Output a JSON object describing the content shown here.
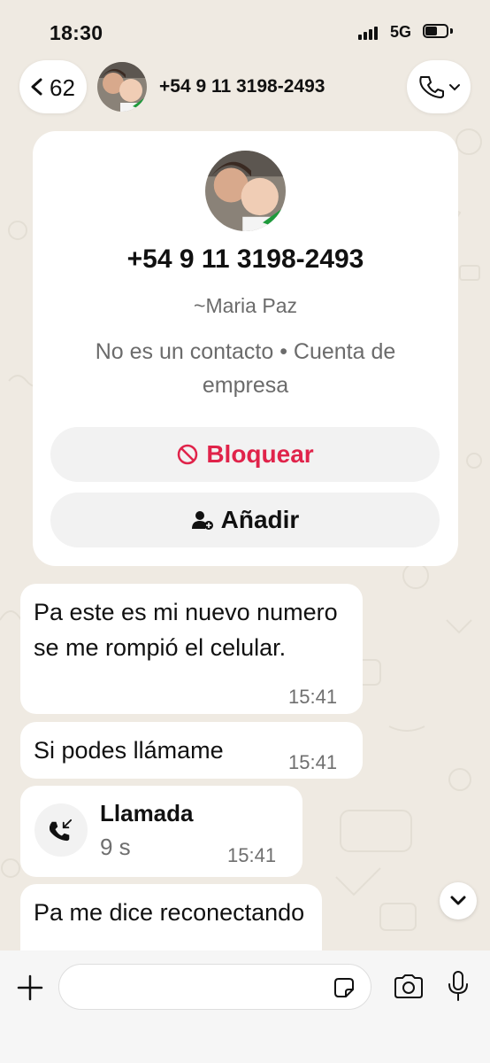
{
  "status_bar": {
    "time": "18:30",
    "network": "5G"
  },
  "header": {
    "back_count": "62",
    "contact_name": "+54 9 11 3198-2493",
    "icons": {
      "back": "chevron-left-icon",
      "call": "phone-icon",
      "call_menu": "chevron-down-icon"
    }
  },
  "info_card": {
    "phone": "+54 9 11 3198-2493",
    "alias": "~Maria Paz",
    "status": "No es un contacto • Cuenta de empresa",
    "block_label": "Bloquear",
    "add_label": "Añadir"
  },
  "messages": [
    {
      "text": "Pa este es mi nuevo numero se me rompió el celular.",
      "time": "15:41"
    },
    {
      "text": "Si podes llámame",
      "time": "15:41"
    },
    {
      "type": "call",
      "title": "Llamada",
      "duration": "9 s",
      "time": "15:41"
    },
    {
      "text": "Pa me dice reconectando"
    }
  ],
  "colors": {
    "block_red": "#e0234a",
    "bubble": "#ffffff",
    "wallpaper": "#efeae2"
  }
}
